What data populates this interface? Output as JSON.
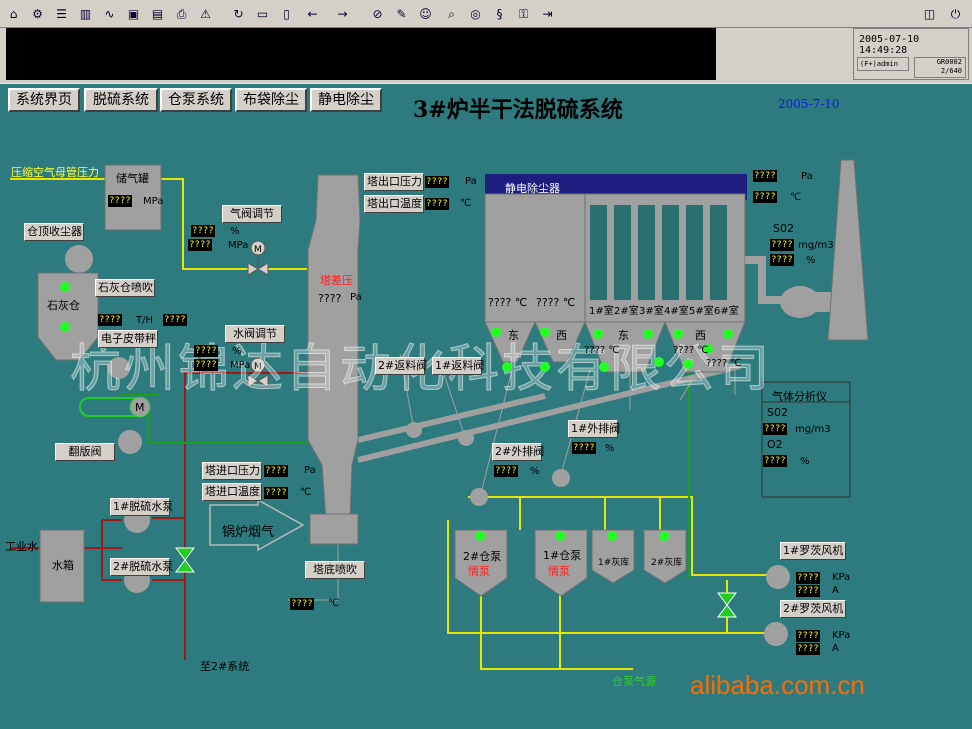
{
  "toolbar": {
    "icons": [
      "home-icon",
      "setup-icon",
      "list-icon",
      "chart-icon",
      "trend-icon",
      "monitor-icon",
      "report-icon",
      "print-icon",
      "alarm-icon",
      "refresh-icon",
      "doc-icon",
      "book-icon",
      "back-icon",
      "forward-icon",
      "stop-icon",
      "edit-icon",
      "user-icon",
      "find-icon",
      "binoculars-icon",
      "switch-icon",
      "key-icon",
      "logout-icon",
      "map-icon",
      "exit-icon"
    ]
  },
  "header": {
    "datetime": "2005-07-10 14:49:28",
    "user": "(F+)admin",
    "page_code": "GR0002",
    "resolution": "2/640"
  },
  "nav": {
    "tabs": [
      "系统界页",
      "脱硫系统",
      "仓泵系统",
      "布袋除尘",
      "静电除尘"
    ]
  },
  "page": {
    "title": "3#炉半干法脱硫系统",
    "date": "2005-7-10",
    "watermark": "杭州锦达自动化科技有限公司",
    "brand": "alibaba.com.cn"
  },
  "labels": {
    "compressed_air": "压缩空气母管压力",
    "gas_tank": "储气罐",
    "silo_dust": "仓顶收尘器",
    "lime_silo": "石灰仓",
    "lime_blow": "石灰仓喷吹",
    "belt_scale": "电子皮带秤",
    "flap_valve": "翻版阀",
    "gas_valve": "气阀调节",
    "water_valve": "水阀调节",
    "tower_dp": "塔差压",
    "tower_out_p": "塔出口压力",
    "tower_out_t": "塔出口温度",
    "tower_in_p": "塔进口压力",
    "tower_in_t": "塔进口温度",
    "boiler_gas": "锅炉烟气",
    "tower_bottom": "塔底喷吹",
    "pump1": "1#脱硫水泵",
    "pump2": "2#脱硫水泵",
    "water_tank": "水箱",
    "industrial_water": "工业水",
    "to_sys2": "至2#系统",
    "esp": "静电除尘器",
    "return2": "2#返料阀",
    "return1": "1#返料阀",
    "vent2": "2#外排阀",
    "vent1": "1#外排阀",
    "bin_pump2": "2#仓泵",
    "bin_pump1": "1#仓泵",
    "ash1": "1#灰库",
    "ash2": "2#灰库",
    "pump_gas": "仓泵气源",
    "blower1": "1#罗茨风机",
    "blower2": "2#罗茨风机",
    "analyzer": "气体分析仪",
    "east": "东",
    "west": "西",
    "idle": "情泵",
    "rooms": [
      "1#室",
      "2#室",
      "3#室",
      "4#室",
      "5#室",
      "6#室"
    ]
  },
  "values": {
    "q": "????"
  },
  "units": {
    "mpa": "MPa",
    "pa": "Pa",
    "c": "℃",
    "pct": "%",
    "th": "T/H",
    "so2": "S02",
    "o2": "O2",
    "mgm3": "mg/m3",
    "kpa": "KPa",
    "a": "A",
    "so2_label": "S02",
    "o2_label": "O2"
  },
  "colors": {
    "panel": "#2d7b7e",
    "pipe_yellow": "#e6e600",
    "pipe_red": "#a01818",
    "pipe_green": "#18a018",
    "pipe_gray": "#a0a0a0",
    "status_green": "#22ff22"
  }
}
